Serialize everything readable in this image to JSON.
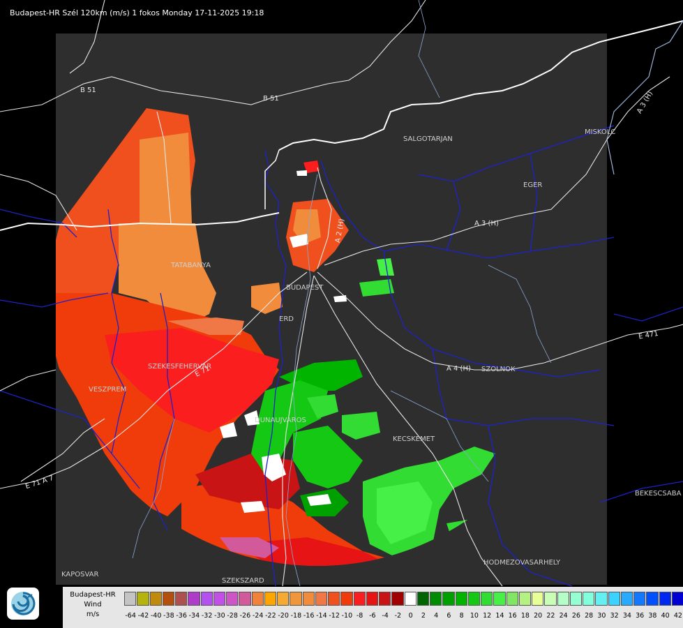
{
  "title": "Budapest-HR Szél 120km (m/s) 1 fokos Monday 17-11-2025 19:18",
  "cities": [
    {
      "id": "salgotarjan",
      "name": "SALGOTARJAN"
    },
    {
      "id": "miskolc",
      "name": "MISKOLC"
    },
    {
      "id": "eger",
      "name": "EGER"
    },
    {
      "id": "tatabanya",
      "name": "TATABANYA"
    },
    {
      "id": "budapest",
      "name": "BUDAPEST"
    },
    {
      "id": "erd",
      "name": "ERD"
    },
    {
      "id": "szekesfehervar",
      "name": "SZEKESFEHERVAR"
    },
    {
      "id": "veszprem",
      "name": "VESZPREM"
    },
    {
      "id": "szolnok",
      "name": "SZOLNOK"
    },
    {
      "id": "dunaujvaros",
      "name": "DUNAUJVAROS"
    },
    {
      "id": "kecskemet",
      "name": "KECSKEMET"
    },
    {
      "id": "bekescsaba",
      "name": "BEKESCSABA"
    },
    {
      "id": "hodmezovasarhely",
      "name": "HODMEZOVASARHELY"
    },
    {
      "id": "kaposvar",
      "name": "KAPOSVAR"
    },
    {
      "id": "szekszard",
      "name": "SZEKSZARD"
    }
  ],
  "roads": [
    {
      "id": "b51-a",
      "name": "B 51"
    },
    {
      "id": "b51-b",
      "name": "B 51"
    },
    {
      "id": "a3-a",
      "name": "A 3 (H)"
    },
    {
      "id": "a3-b",
      "name": "A 3 (H)"
    },
    {
      "id": "a4",
      "name": "A 4 (H)"
    },
    {
      "id": "e71",
      "name": "E 71"
    },
    {
      "id": "e71-a7",
      "name": "E 71 A 7"
    },
    {
      "id": "e47",
      "name": "E 471"
    },
    {
      "id": "a2",
      "name": "A 2 (H)"
    }
  ],
  "legend": {
    "station": "Budapest-HR",
    "quantity": "Wind",
    "unit": "m/s",
    "scale": [
      {
        "value": "-64",
        "color": "#c4c4c4"
      },
      {
        "value": "-42",
        "color": "#b4b40c"
      },
      {
        "value": "-40",
        "color": "#c08a0c"
      },
      {
        "value": "-38",
        "color": "#b4500c"
      },
      {
        "value": "-36",
        "color": "#ae5050"
      },
      {
        "value": "-34",
        "color": "#ae3cc8"
      },
      {
        "value": "-32",
        "color": "#b450f0"
      },
      {
        "value": "-30",
        "color": "#c350e6"
      },
      {
        "value": "-28",
        "color": "#cd55c8"
      },
      {
        "value": "-26",
        "color": "#d25a9b"
      },
      {
        "value": "-24",
        "color": "#f0823c"
      },
      {
        "value": "-22",
        "color": "#ffa500"
      },
      {
        "value": "-20",
        "color": "#f5aa32"
      },
      {
        "value": "-18",
        "color": "#f0963c"
      },
      {
        "value": "-16",
        "color": "#f08c3c"
      },
      {
        "value": "-14",
        "color": "#f07846"
      },
      {
        "value": "-12",
        "color": "#f0501e"
      },
      {
        "value": "-10",
        "color": "#f03c0a"
      },
      {
        "value": "-8",
        "color": "#fa1e1e"
      },
      {
        "value": "-6",
        "color": "#e61414"
      },
      {
        "value": "-4",
        "color": "#c81414"
      },
      {
        "value": "-2",
        "color": "#a00000"
      },
      {
        "value": "0",
        "color": "#ffffff"
      },
      {
        "value": "2",
        "color": "#006400"
      },
      {
        "value": "4",
        "color": "#008c00"
      },
      {
        "value": "6",
        "color": "#00a000"
      },
      {
        "value": "8",
        "color": "#00b400"
      },
      {
        "value": "10",
        "color": "#14c814"
      },
      {
        "value": "12",
        "color": "#32dc32"
      },
      {
        "value": "14",
        "color": "#46f046"
      },
      {
        "value": "16",
        "color": "#82e664"
      },
      {
        "value": "18",
        "color": "#b4f082"
      },
      {
        "value": "20",
        "color": "#e6ff96"
      },
      {
        "value": "22",
        "color": "#c8ffb4"
      },
      {
        "value": "24",
        "color": "#b4ffc8"
      },
      {
        "value": "26",
        "color": "#96ffd2"
      },
      {
        "value": "28",
        "color": "#82ffdc"
      },
      {
        "value": "30",
        "color": "#64f0f0"
      },
      {
        "value": "32",
        "color": "#3cd2ff"
      },
      {
        "value": "34",
        "color": "#28aaff"
      },
      {
        "value": "36",
        "color": "#1478ff"
      },
      {
        "value": "38",
        "color": "#0050ff"
      },
      {
        "value": "40",
        "color": "#0028f0"
      },
      {
        "value": "42",
        "color": "#0000d2"
      }
    ]
  }
}
